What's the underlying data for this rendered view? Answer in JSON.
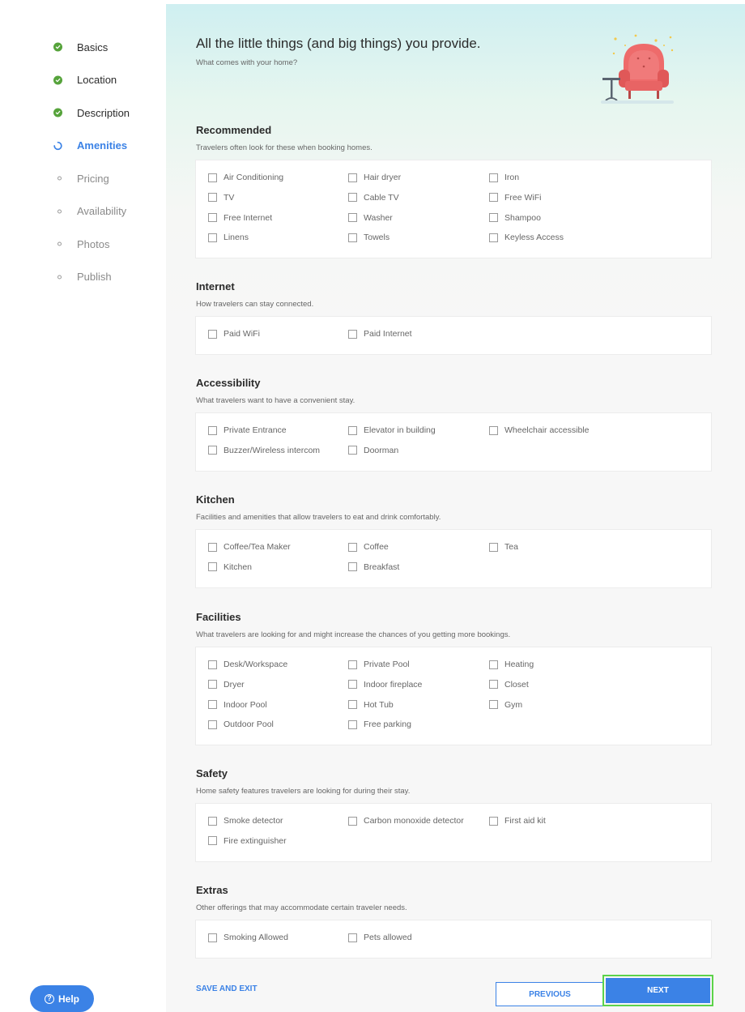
{
  "sidebar": {
    "steps": [
      {
        "label": "Basics",
        "state": "done"
      },
      {
        "label": "Location",
        "state": "done"
      },
      {
        "label": "Description",
        "state": "done"
      },
      {
        "label": "Amenities",
        "state": "active"
      },
      {
        "label": "Pricing",
        "state": "pending"
      },
      {
        "label": "Availability",
        "state": "pending"
      },
      {
        "label": "Photos",
        "state": "pending"
      },
      {
        "label": "Publish",
        "state": "pending"
      }
    ],
    "help_label": "Help",
    "help_icon": "question-circle-icon"
  },
  "header": {
    "title": "All the little things (and big things) you provide.",
    "subtitle": "What comes with your home?",
    "illustration": "armchair-illustration"
  },
  "sections": [
    {
      "title": "Recommended",
      "description": "Travelers often look for these when booking homes.",
      "options": [
        "Air Conditioning",
        "Hair dryer",
        "Iron",
        "TV",
        "Cable TV",
        "Free WiFi",
        "Free Internet",
        "Washer",
        "Shampoo",
        "Linens",
        "Towels",
        "Keyless Access"
      ]
    },
    {
      "title": "Internet",
      "description": "How travelers can stay connected.",
      "options": [
        "Paid WiFi",
        "Paid Internet"
      ]
    },
    {
      "title": "Accessibility",
      "description": "What travelers want to have a convenient stay.",
      "options": [
        "Private Entrance",
        "Elevator in building",
        "Wheelchair accessible",
        "Buzzer/Wireless intercom",
        "Doorman"
      ]
    },
    {
      "title": "Kitchen",
      "description": "Facilities and amenities that allow travelers to eat and drink comfortably.",
      "options": [
        "Coffee/Tea Maker",
        "Coffee",
        "Tea",
        "Kitchen",
        "Breakfast"
      ]
    },
    {
      "title": "Facilities",
      "description": "What travelers are looking for and might increase the chances of you getting more bookings.",
      "options": [
        "Desk/Workspace",
        "Private Pool",
        "Heating",
        "Dryer",
        "Indoor fireplace",
        "Closet",
        "Indoor Pool",
        "Hot Tub",
        "Gym",
        "Outdoor Pool",
        "Free parking"
      ]
    },
    {
      "title": "Safety",
      "description": "Home safety features travelers are looking for during their stay.",
      "options": [
        "Smoke detector",
        "Carbon monoxide detector",
        "First aid kit",
        "Fire extinguisher"
      ]
    },
    {
      "title": "Extras",
      "description": "Other offerings that may accommodate certain traveler needs.",
      "options": [
        "Smoking Allowed",
        "Pets allowed"
      ]
    }
  ],
  "footer": {
    "save_exit_label": "SAVE AND EXIT",
    "previous_label": "PREVIOUS",
    "next_label": "NEXT"
  },
  "colors": {
    "accent": "#3b82e6",
    "done_green": "#56a33b",
    "highlight_green": "#5cd34a"
  }
}
